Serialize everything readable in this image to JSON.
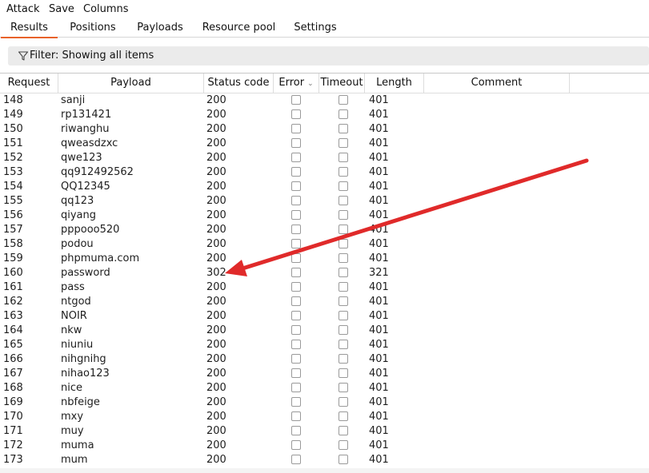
{
  "menu": [
    "Attack",
    "Save",
    "Columns"
  ],
  "tabs": [
    "Results",
    "Positions",
    "Payloads",
    "Resource pool",
    "Settings"
  ],
  "active_tab": 0,
  "filter_text": "Filter: Showing all items",
  "columns": [
    "Request",
    "Payload",
    "Status code",
    "Error",
    "Timeout",
    "Length",
    "Comment"
  ],
  "rows": [
    {
      "request": "148",
      "payload": "sanji",
      "status": "200",
      "length": "401"
    },
    {
      "request": "149",
      "payload": "rp131421",
      "status": "200",
      "length": "401"
    },
    {
      "request": "150",
      "payload": "riwanghu",
      "status": "200",
      "length": "401"
    },
    {
      "request": "151",
      "payload": "qweasdzxc",
      "status": "200",
      "length": "401"
    },
    {
      "request": "152",
      "payload": "qwe123",
      "status": "200",
      "length": "401"
    },
    {
      "request": "153",
      "payload": "qq912492562",
      "status": "200",
      "length": "401"
    },
    {
      "request": "154",
      "payload": "QQ12345",
      "status": "200",
      "length": "401"
    },
    {
      "request": "155",
      "payload": "qq123",
      "status": "200",
      "length": "401"
    },
    {
      "request": "156",
      "payload": "qiyang",
      "status": "200",
      "length": "401"
    },
    {
      "request": "157",
      "payload": "pppooo520",
      "status": "200",
      "length": "401"
    },
    {
      "request": "158",
      "payload": "podou",
      "status": "200",
      "length": "401"
    },
    {
      "request": "159",
      "payload": "phpmuma.com",
      "status": "200",
      "length": "401"
    },
    {
      "request": "160",
      "payload": "password",
      "status": "302",
      "length": "321"
    },
    {
      "request": "161",
      "payload": "pass",
      "status": "200",
      "length": "401"
    },
    {
      "request": "162",
      "payload": "ntgod",
      "status": "200",
      "length": "401"
    },
    {
      "request": "163",
      "payload": "NOIR",
      "status": "200",
      "length": "401"
    },
    {
      "request": "164",
      "payload": "nkw",
      "status": "200",
      "length": "401"
    },
    {
      "request": "165",
      "payload": "niuniu",
      "status": "200",
      "length": "401"
    },
    {
      "request": "166",
      "payload": "nihgnihg",
      "status": "200",
      "length": "401"
    },
    {
      "request": "167",
      "payload": "nihao123",
      "status": "200",
      "length": "401"
    },
    {
      "request": "168",
      "payload": "nice",
      "status": "200",
      "length": "401"
    },
    {
      "request": "169",
      "payload": "nbfeige",
      "status": "200",
      "length": "401"
    },
    {
      "request": "170",
      "payload": "mxy",
      "status": "200",
      "length": "401"
    },
    {
      "request": "171",
      "payload": "muy",
      "status": "200",
      "length": "401"
    },
    {
      "request": "172",
      "payload": "muma",
      "status": "200",
      "length": "401"
    },
    {
      "request": "173",
      "payload": "mum",
      "status": "200",
      "length": "401"
    }
  ],
  "colors": {
    "accent": "#e8622a",
    "arrow": "#e02a2a"
  }
}
